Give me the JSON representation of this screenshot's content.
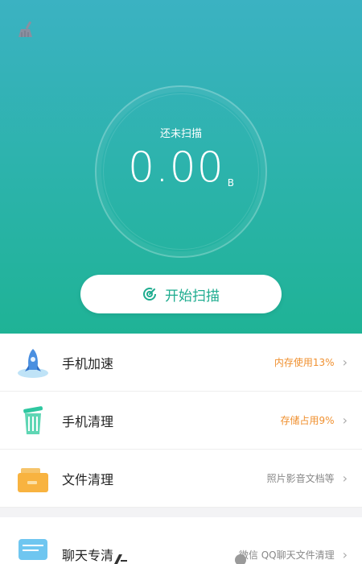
{
  "hero": {
    "scan_status": "还未扫描",
    "size_value": "0.00",
    "size_unit": "B",
    "scan_button_label": "开始扫描"
  },
  "items": [
    {
      "icon": "rocket-icon",
      "title": "手机加速",
      "hint": "内存使用13%"
    },
    {
      "icon": "trash-can-icon",
      "title": "手机清理",
      "hint": "存储占用9%"
    },
    {
      "icon": "folder-icon",
      "title": "文件清理",
      "hint": "照片影音文档等"
    },
    {
      "icon": "chat-icon",
      "title": "聊天专清",
      "hint": "微信 QQ聊天文件清理"
    }
  ],
  "colors": {
    "accent": "#1eac8f",
    "hero_top": "#3bb2c2",
    "hero_bottom": "#1fb396",
    "hint_orange": "#f0902f"
  }
}
